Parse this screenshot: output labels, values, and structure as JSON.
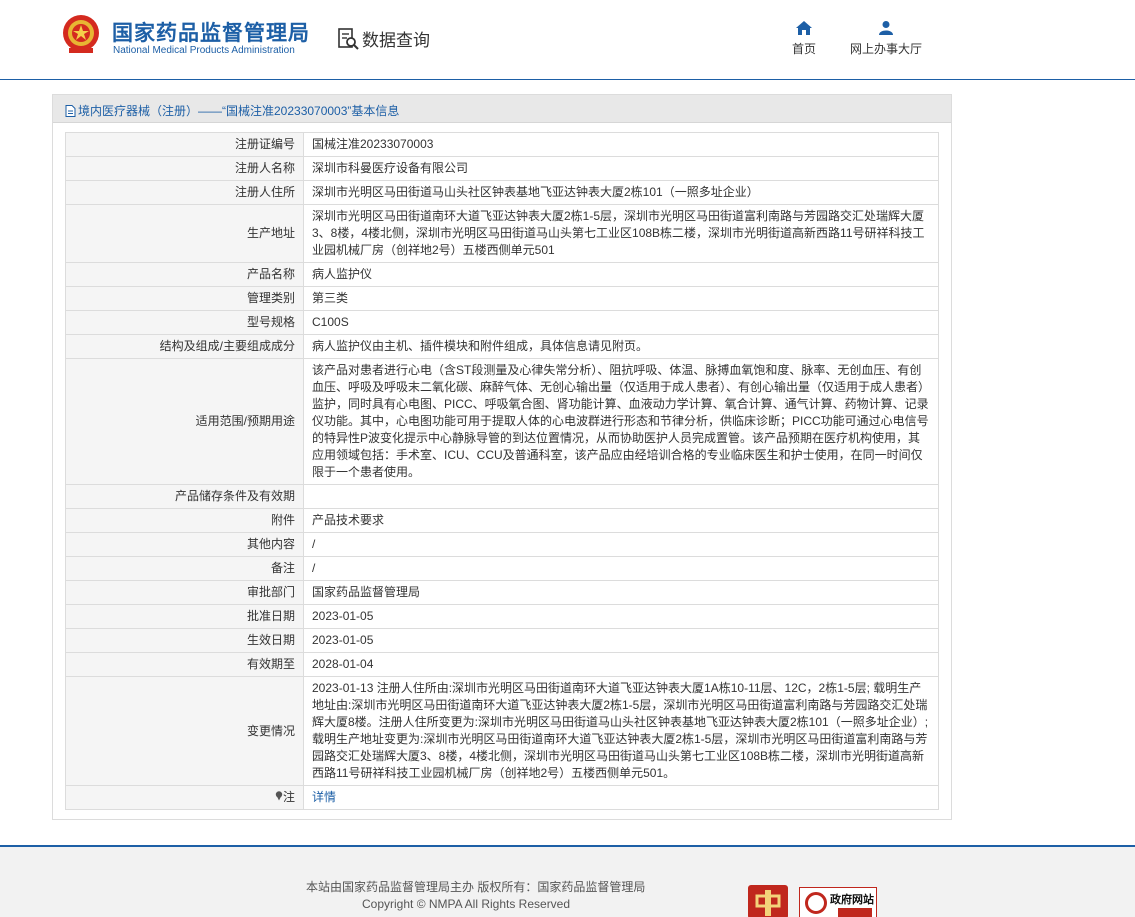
{
  "header": {
    "brand_cn": "国家药品监督管理局",
    "brand_en": "National Medical Products Administration",
    "query_label": "数据查询",
    "nav": [
      {
        "label": "首页",
        "icon": "home-icon"
      },
      {
        "label": "网上办事大厅",
        "icon": "user-icon"
      }
    ]
  },
  "breadcrumb": "境内医疗器械（注册）——“国械注准20233070003”基本信息",
  "fields": [
    {
      "key": "注册证编号",
      "value": "国械注准20233070003"
    },
    {
      "key": "注册人名称",
      "value": "深圳市科曼医疗设备有限公司"
    },
    {
      "key": "注册人住所",
      "value": "深圳市光明区马田街道马山头社区钟表基地飞亚达钟表大厦2栋101（一照多址企业）"
    },
    {
      "key": "生产地址",
      "value": "深圳市光明区马田街道南环大道飞亚达钟表大厦2栋1-5层，深圳市光明区马田街道富利南路与芳园路交汇处瑞辉大厦3、8楼，4楼北侧，深圳市光明区马田街道马山头第七工业区108B栋二楼，深圳市光明街道高新西路11号研祥科技工业园机械厂房（创祥地2号）五楼西侧单元501"
    },
    {
      "key": "产品名称",
      "value": "病人监护仪"
    },
    {
      "key": "管理类别",
      "value": "第三类"
    },
    {
      "key": "型号规格",
      "value": "C100S"
    },
    {
      "key": "结构及组成/主要组成成分",
      "value": "病人监护仪由主机、插件模块和附件组成，具体信息请见附页。"
    },
    {
      "key": "适用范围/预期用途",
      "value": "该产品对患者进行心电（含ST段测量及心律失常分析）、阻抗呼吸、体温、脉搏血氧饱和度、脉率、无创血压、有创血压、呼吸及呼吸末二氧化碳、麻醉气体、无创心输出量（仅适用于成人患者）、有创心输出量（仅适用于成人患者）监护，同时具有心电图、PICC、呼吸氧合图、肾功能计算、血液动力学计算、氧合计算、通气计算、药物计算、记录仪功能。其中，心电图功能可用于提取人体的心电波群进行形态和节律分析，供临床诊断；PICC功能可通过心电信号的特异性P波变化提示中心静脉导管的到达位置情况，从而协助医护人员完成置管。该产品预期在医疗机构使用，其应用领域包括：手术室、ICU、CCU及普通科室，该产品应由经培训合格的专业临床医生和护士使用，在同一时间仅限于一个患者使用。"
    },
    {
      "key": "产品储存条件及有效期",
      "value": ""
    },
    {
      "key": "附件",
      "value": "产品技术要求"
    },
    {
      "key": "其他内容",
      "value": "/"
    },
    {
      "key": "备注",
      "value": "/"
    },
    {
      "key": "审批部门",
      "value": "国家药品监督管理局"
    },
    {
      "key": "批准日期",
      "value": "2023-01-05"
    },
    {
      "key": "生效日期",
      "value": "2023-01-05"
    },
    {
      "key": "有效期至",
      "value": "2028-01-04"
    },
    {
      "key": "变更情况",
      "value": "2023-01-13 注册人住所由:深圳市光明区马田街道南环大道飞亚达钟表大厦1A栋10-11层、12C，2栋1-5层; 载明生产地址由:深圳市光明区马田街道南环大道飞亚达钟表大厦2栋1-5层，深圳市光明区马田街道富利南路与芳园路交汇处瑞辉大厦8楼。注册人住所变更为:深圳市光明区马田街道马山头社区钟表基地飞亚达钟表大厦2栋101（一照多址企业）; 载明生产地址变更为:深圳市光明区马田街道南环大道飞亚达钟表大厦2栋1-5层，深圳市光明区马田街道富利南路与芳园路交汇处瑞辉大厦3、8楼，4楼北侧，深圳市光明区马田街道马山头第七工业区108B栋二楼，深圳市光明街道高新西路11号研祥科技工业园机械厂房（创祥地2号）五楼西侧单元501。"
    }
  ],
  "note": {
    "key": "注",
    "link": "详情",
    "icon": "pin-icon"
  },
  "footer": {
    "line1": "本站由国家药品监督管理局主办 版权所有：国家药品监督管理局",
    "line2": "Copyright © NMPA All Rights Reserved",
    "gov_badge_text": "政府网站"
  },
  "colors": {
    "brand_blue": "#1d5fa6",
    "label_bg": "#f5f5f5",
    "badge_red": "#c0271d"
  }
}
